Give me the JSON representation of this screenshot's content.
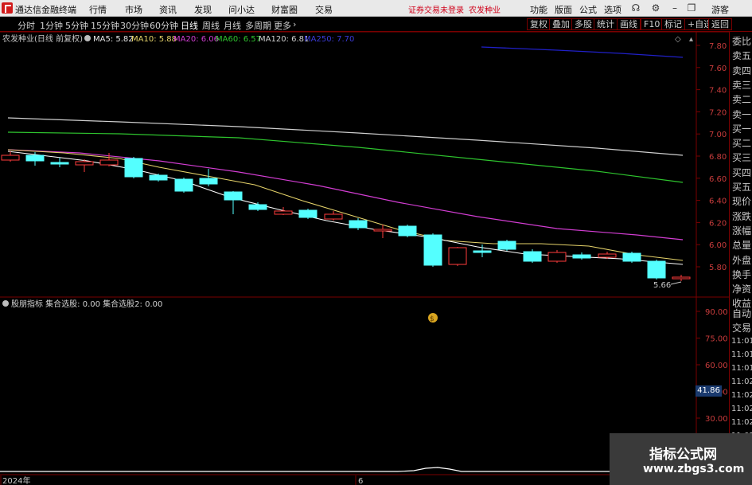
{
  "menubar": {
    "app_title": "通达信金融终端",
    "items": [
      "行情",
      "市场",
      "资讯",
      "发现",
      "问小达",
      "财富圈",
      "交易"
    ],
    "status_left": "证券交易未登录",
    "status_right": "农发种业",
    "right_items": [
      "功能",
      "版面",
      "公式",
      "选项"
    ],
    "guest": "游客"
  },
  "toolbar": {
    "periods": [
      "分时",
      "1分钟",
      "5分钟",
      "15分钟",
      "30分钟",
      "60分钟",
      "日线",
      "周线",
      "月线",
      "多周期",
      "更多"
    ],
    "active_period": "日线",
    "right_buttons": [
      "复权",
      "叠加",
      "多股",
      "统计",
      "画线",
      "F10",
      "标记",
      "+自选",
      "返回"
    ]
  },
  "main_chart": {
    "header_name": "农发种业(日线 前复权)",
    "ma_labels": [
      {
        "text": "MA5: 5.82",
        "color": "#e8e8e8"
      },
      {
        "text": "MA10: 5.88",
        "color": "#e6d36a"
      },
      {
        "text": "MA20: 6.06",
        "color": "#d23dd2"
      },
      {
        "text": "MA60: 6.57",
        "color": "#2ec42e"
      },
      {
        "text": "MA120: 6.81",
        "color": "#cfcfcf"
      },
      {
        "text": "MA250: 7.70",
        "color": "#3a3ad8"
      }
    ],
    "y_ticks": [
      "7.80",
      "7.60",
      "7.40",
      "7.20",
      "7.00",
      "6.80",
      "6.60",
      "6.40",
      "6.20",
      "6.00",
      "5.80"
    ],
    "low_marker": "5.66",
    "up_color": "#ff3b3b",
    "down_color": "#54ffff"
  },
  "indicator": {
    "header": "股朋指标 集合选股: 0.00 集合选股2: 0.00",
    "y_ticks": [
      "90.00",
      "75.00",
      "60.00",
      "45.00",
      "30.00"
    ],
    "price_badge": "41.86"
  },
  "x_axis": {
    "labels": [
      "2024年",
      "6"
    ]
  },
  "right_panel": {
    "top_items": [
      "委比",
      "卖五",
      "卖四",
      "卖三",
      "卖二",
      "卖一",
      "买一",
      "买二",
      "买三",
      "买四",
      "买五",
      "现价",
      "涨跌",
      "涨幅",
      "总量",
      "外盘",
      "换手",
      "净资",
      "收益"
    ],
    "bottom_items": [
      "自动",
      "交易"
    ],
    "time_items": [
      "11:01",
      "11:01",
      "11:01",
      "11:02",
      "11:02",
      "11:02",
      "11:02",
      "11:02",
      "11:02",
      "11:02"
    ]
  },
  "watermark": {
    "line1": "指标公式网",
    "line2": "www.zbgs3.com"
  }
}
